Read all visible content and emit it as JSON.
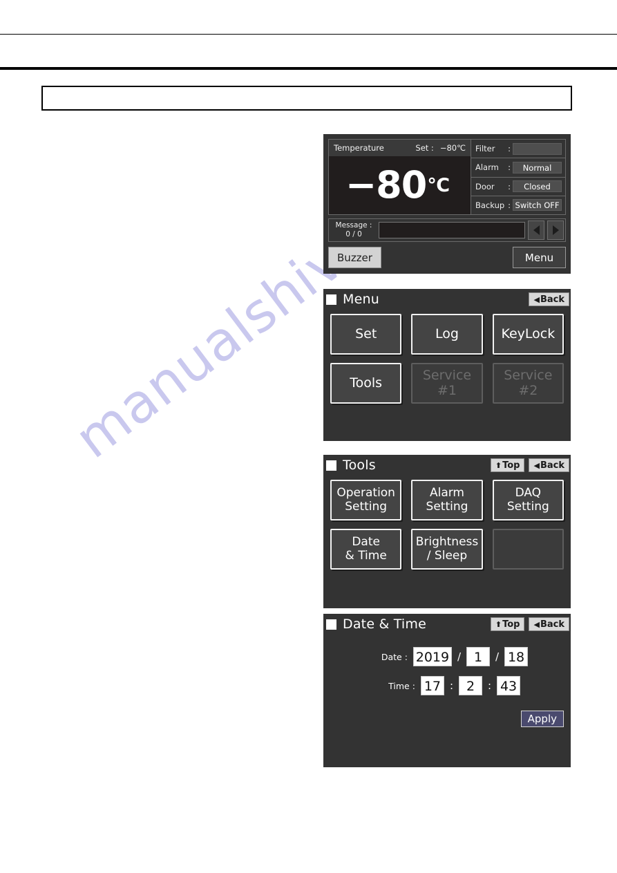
{
  "page": {
    "watermark": "manualshive.com"
  },
  "header": {
    "box_text": ""
  },
  "home_screen": {
    "temperature": {
      "label": "Temperature",
      "set_label": "Set :",
      "set_value": "−80℃",
      "value": "−80",
      "unit": "℃"
    },
    "status_rows": [
      {
        "label": "Filter",
        "colon": ":",
        "value": ""
      },
      {
        "label": "Alarm",
        "colon": ":",
        "value": "Normal"
      },
      {
        "label": "Door",
        "colon": ":",
        "value": "Closed"
      },
      {
        "label": "Backup",
        "colon": ":",
        "value": "Switch OFF"
      }
    ],
    "message": {
      "label": "Message :",
      "count": "0 / 0",
      "text": "",
      "prev_icon": "triangle-left-icon",
      "next_icon": "triangle-right-icon"
    },
    "buzzer_label": "Buzzer",
    "menu_label": "Menu"
  },
  "menu_screen": {
    "title": "Menu",
    "nav": [
      {
        "label": "Back",
        "glyph": "◀",
        "icon": "back-arrow-icon"
      }
    ],
    "tiles": [
      {
        "label": "Set",
        "state": "enabled"
      },
      {
        "label": "Log",
        "state": "enabled"
      },
      {
        "label": "KeyLock",
        "state": "enabled"
      },
      {
        "label": "Tools",
        "state": "enabled"
      },
      {
        "label": "Service #1",
        "state": "disabled"
      },
      {
        "label": "Service #2",
        "state": "disabled"
      }
    ]
  },
  "tools_screen": {
    "title": "Tools",
    "nav": [
      {
        "label": "Top",
        "glyph": "⬆",
        "icon": "top-arrow-icon"
      },
      {
        "label": "Back",
        "glyph": "◀",
        "icon": "back-arrow-icon"
      }
    ],
    "tiles": [
      {
        "line1": "Operation",
        "line2": "Setting",
        "state": "enabled"
      },
      {
        "line1": "Alarm",
        "line2": "Setting",
        "state": "enabled"
      },
      {
        "line1": "DAQ",
        "line2": "Setting",
        "state": "enabled"
      },
      {
        "line1": "Date",
        "line2": "& Time",
        "state": "enabled"
      },
      {
        "line1": "Brightness",
        "line2": "/ Sleep",
        "state": "enabled"
      },
      {
        "line1": "",
        "line2": "",
        "state": "blank"
      }
    ]
  },
  "datetime_screen": {
    "title": "Date & Time",
    "nav": [
      {
        "label": "Top",
        "glyph": "⬆",
        "icon": "top-arrow-icon"
      },
      {
        "label": "Back",
        "glyph": "◀",
        "icon": "back-arrow-icon"
      }
    ],
    "date": {
      "label": "Date :",
      "year": "2019",
      "sep1": "/",
      "month": "1",
      "sep2": "/",
      "day": "18"
    },
    "time": {
      "label": "Time :",
      "hour": "17",
      "sep1": ":",
      "minute": "2",
      "sep2": ":",
      "second": "43"
    },
    "apply_label": "Apply"
  },
  "colors": {
    "panel_bg": "#333333",
    "tile_bg": "#444444",
    "temp_bg": "#211d1d",
    "status_value_bg": "#4e4e4e",
    "nav_btn_bg": "#d8d8d8",
    "buzzer_bg": "#d3d3d3",
    "apply_bg": "#4a4a6e",
    "watermark": "#c9c8ee"
  }
}
